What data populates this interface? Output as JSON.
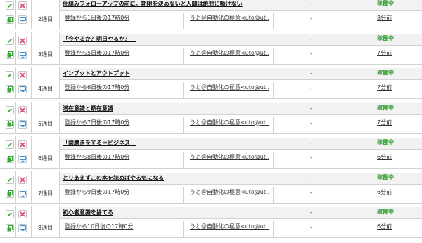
{
  "icons": {
    "edit": "pencil-icon",
    "delete": "close-x-icon",
    "copy": "copy-document-icon",
    "preview": "monitor-icon"
  },
  "colors": {
    "edit_green": "#3aa63a",
    "delete_pink": "#e0457b",
    "copy_green": "#3aa63a",
    "preview_blue": "#3a8fd6",
    "status_green": "#2e9e2e"
  },
  "rows": [
    {
      "step": "2通目",
      "title": "仕組みフォローアップの前に。期限を決めないと人間は絶対に動けない",
      "timing": "登録から1日後の17時0分",
      "sender": "うと＠自動化の極意<uto@ut...",
      "dash": "-",
      "status": "稼働中",
      "elapsed": "8分前"
    },
    {
      "step": "3通目",
      "title": "「今やるか？明日やるか？」",
      "timing": "登録から5日後の17時0分",
      "sender": "うと＠自動化の極意<uto@ut...",
      "dash": "-",
      "status": "稼働中",
      "elapsed": "7分前"
    },
    {
      "step": "4通目",
      "title": "インプットとアウトプット",
      "timing": "登録から6日後の17時0分",
      "sender": "うと＠自動化の極意<uto@ut...",
      "dash": "-",
      "status": "稼働中",
      "elapsed": "7分前"
    },
    {
      "step": "5通目",
      "title": "潜在意識と顕在意識",
      "timing": "登録から7日後の17時0分",
      "sender": "うと＠自動化の極意<uto@ut...",
      "dash": "-",
      "status": "稼働中",
      "elapsed": "7分前"
    },
    {
      "step": "6通目",
      "title": "「歯磨きをする＝ビジネス」",
      "timing": "登録から8日後の17時0分",
      "sender": "うと＠自動化の極意<uto@ut...",
      "dash": "-",
      "status": "稼働中",
      "elapsed": "6分前"
    },
    {
      "step": "7通目",
      "title": "とりあえずこの本を読めばやる気になる",
      "timing": "登録から9日後の17時0分",
      "sender": "うと＠自動化の極意<uto@ut...",
      "dash": "-",
      "status": "稼働中",
      "elapsed": "6分前"
    },
    {
      "step": "8通目",
      "title": "初心者意識を捨てる",
      "timing": "登録から10日後の17時0分",
      "sender": "うと＠自動化の極意<uto@ut...",
      "dash": "-",
      "status": "稼働中",
      "elapsed": "6分前"
    }
  ]
}
